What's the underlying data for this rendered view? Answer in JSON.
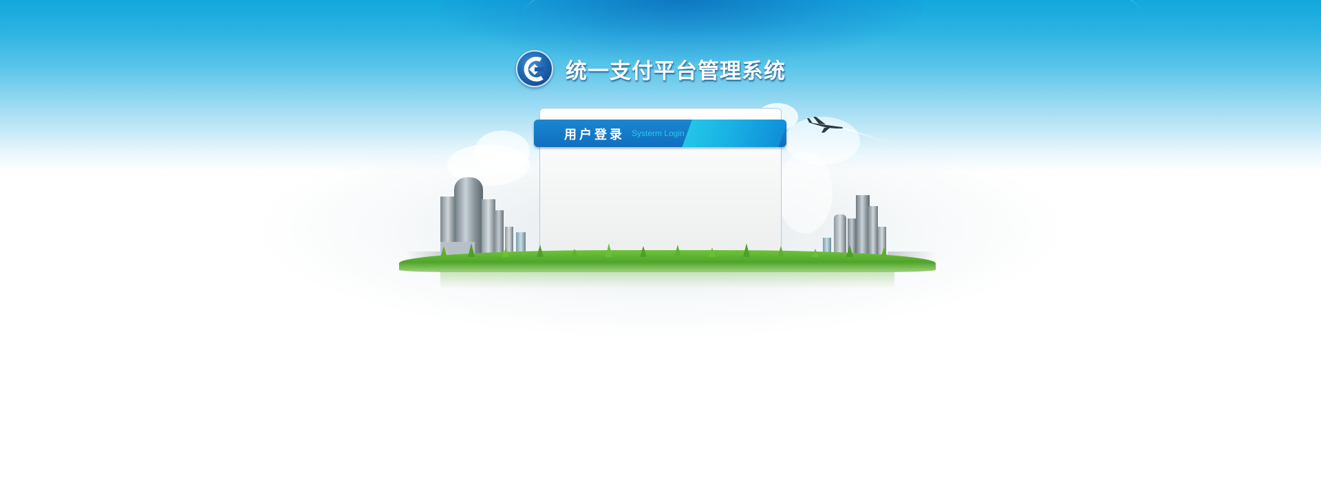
{
  "header": {
    "title": "统一支付平台管理系统",
    "logo_icon": "bank-logo-icon"
  },
  "login": {
    "title": "用户登录",
    "subtitle": "Systerm Login"
  },
  "decor": {
    "plane_icon": "airplane-icon",
    "colors": {
      "sky_top": "#12a7dc",
      "header_blue": "#0f6fbe",
      "accent_cyan": "#22c6e6",
      "grass_green": "#4ea52a"
    }
  }
}
